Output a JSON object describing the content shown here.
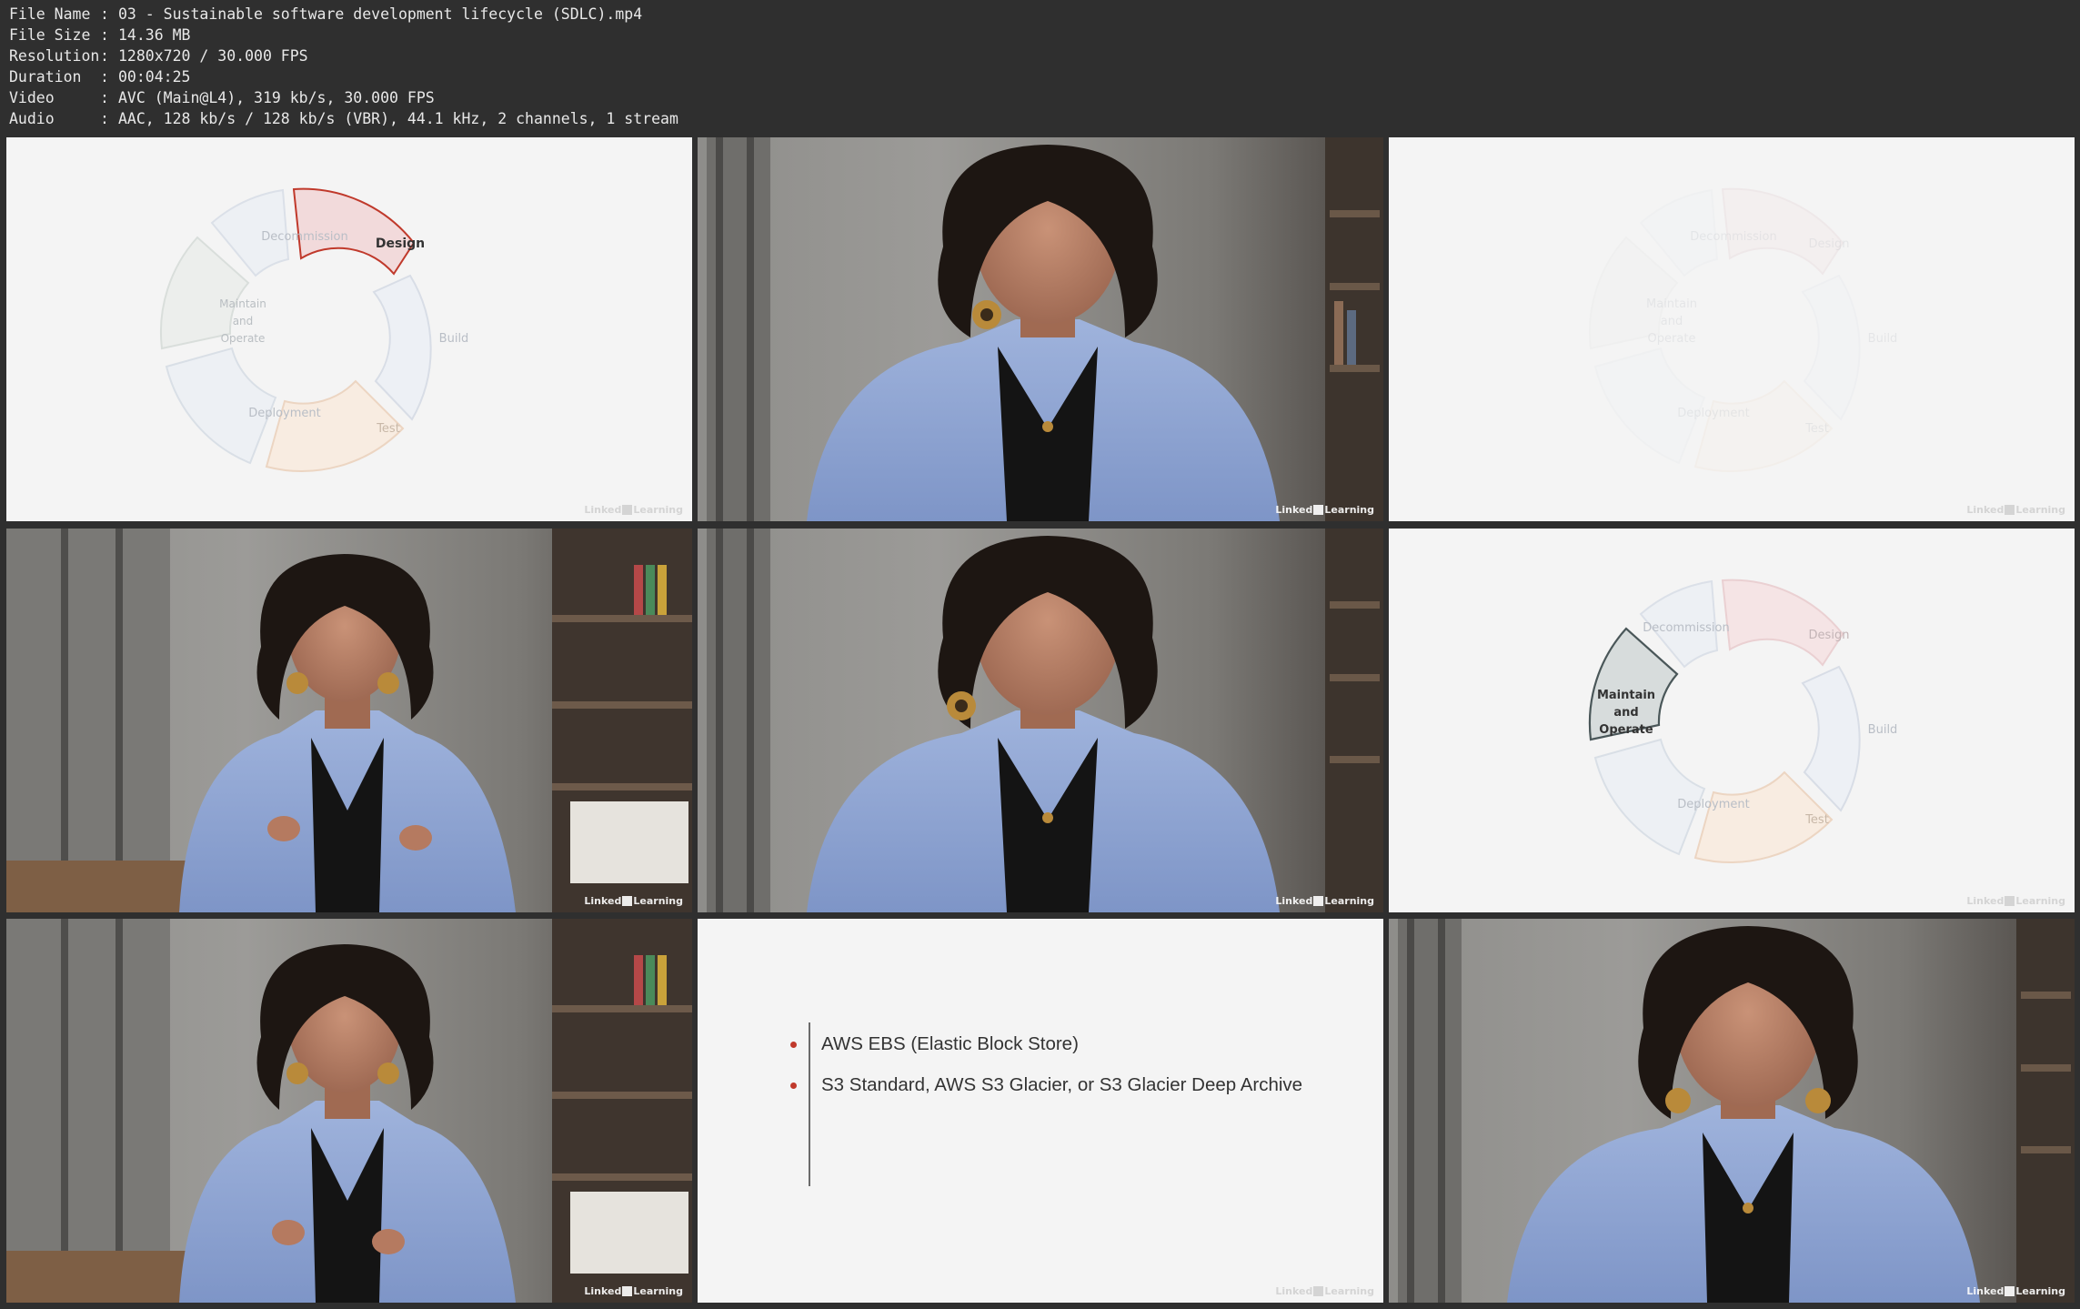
{
  "file_info": [
    {
      "key": "File Name",
      "value": "03 - Sustainable software development lifecycle (SDLC).mp4"
    },
    {
      "key": "File Size",
      "value": "14.36 MB"
    },
    {
      "key": "Resolution",
      "value": "1280x720 / 30.000 FPS"
    },
    {
      "key": "Duration",
      "value": "00:04:25"
    },
    {
      "key": "Video",
      "value": "AVC (Main@L4), 319 kb/s, 30.000 FPS"
    },
    {
      "key": "Audio",
      "value": "AAC, 128 kb/s / 128 kb/s (VBR), 44.1 kHz, 2 channels, 1 stream"
    }
  ],
  "watermark": {
    "left": "Linked",
    "right": "Learning"
  },
  "cycle_labels": {
    "design": "Design",
    "build": "Build",
    "test": "Test",
    "deployment": "Deployment",
    "maintain": [
      "Maintain",
      "and",
      "Operate"
    ],
    "decommission": "Decommission"
  },
  "slide_bullets": [
    "AWS EBS (Elastic Block Store)",
    "S3 Standard, AWS S3 Glacier, or S3 Glacier Deep Archive"
  ],
  "colors": {
    "design": "#f0d6d8",
    "build": "#e8ebf2",
    "test": "#f7e8da",
    "deployment": "#e6ebf1",
    "maintain": "#e7ebe8",
    "decommission": "#e6ebf2",
    "highlight_design": "#c0392b",
    "highlight_maintain": "#4a5759",
    "bullet": "#c0392b"
  }
}
